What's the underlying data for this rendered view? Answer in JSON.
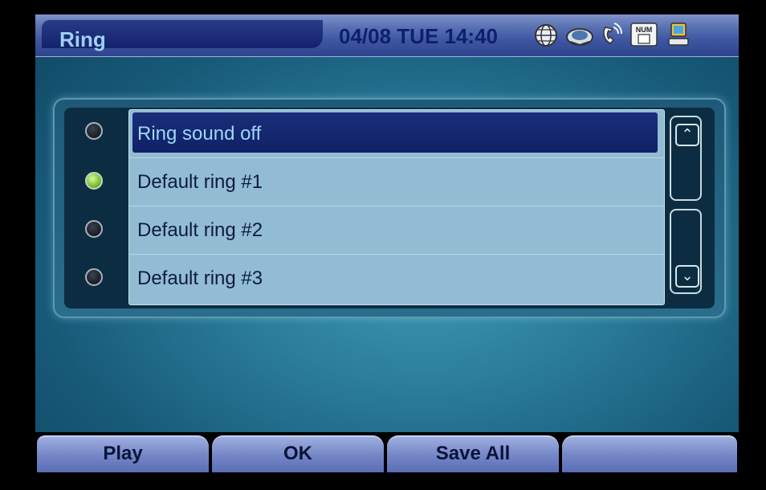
{
  "title": "Ring",
  "header": {
    "datetime": "04/08 TUE 14:40",
    "icons": [
      "globe-icon",
      "satellite-dish-icon",
      "phone-ring-icon",
      "num-lock-icon",
      "network-monitor-icon"
    ],
    "num_label": "NUM"
  },
  "list": {
    "items": [
      {
        "label": "Ring sound off",
        "selected": true,
        "radio_on": false
      },
      {
        "label": "Default ring #1",
        "selected": false,
        "radio_on": true
      },
      {
        "label": "Default ring #2",
        "selected": false,
        "radio_on": false
      },
      {
        "label": "Default ring #3",
        "selected": false,
        "radio_on": false
      }
    ]
  },
  "softkeys": [
    "Play",
    "OK",
    "Save All",
    ""
  ],
  "colors": {
    "accent_selected": "#0f2066",
    "radio_on": "#7ec43a",
    "title_text": "#9fd0f5"
  }
}
